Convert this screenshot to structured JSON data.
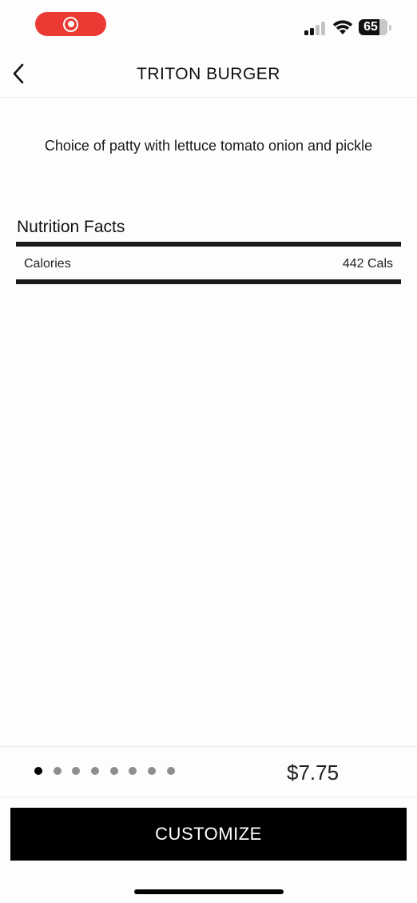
{
  "status_bar": {
    "battery_level": "65",
    "signal_bars_active": 2,
    "signal_bars_total": 4,
    "icons": [
      "screen-record-icon",
      "cellular-signal-icon",
      "wifi-icon",
      "battery-icon"
    ]
  },
  "nav": {
    "title": "TRITON BURGER",
    "back_icon": "chevron-left-icon"
  },
  "item": {
    "description": "Choice of patty with lettuce tomato onion and pickle"
  },
  "nutrition": {
    "heading": "Nutrition Facts",
    "rows": [
      {
        "label": "Calories",
        "value": "442 Cals"
      }
    ]
  },
  "footer": {
    "page_count": 8,
    "active_page": 1,
    "price": "$7.75",
    "customize_label": "CUSTOMIZE"
  },
  "colors": {
    "record_pill": "#ea3a33",
    "button_bg": "#000000",
    "dot_inactive": "#8e8e8e"
  }
}
